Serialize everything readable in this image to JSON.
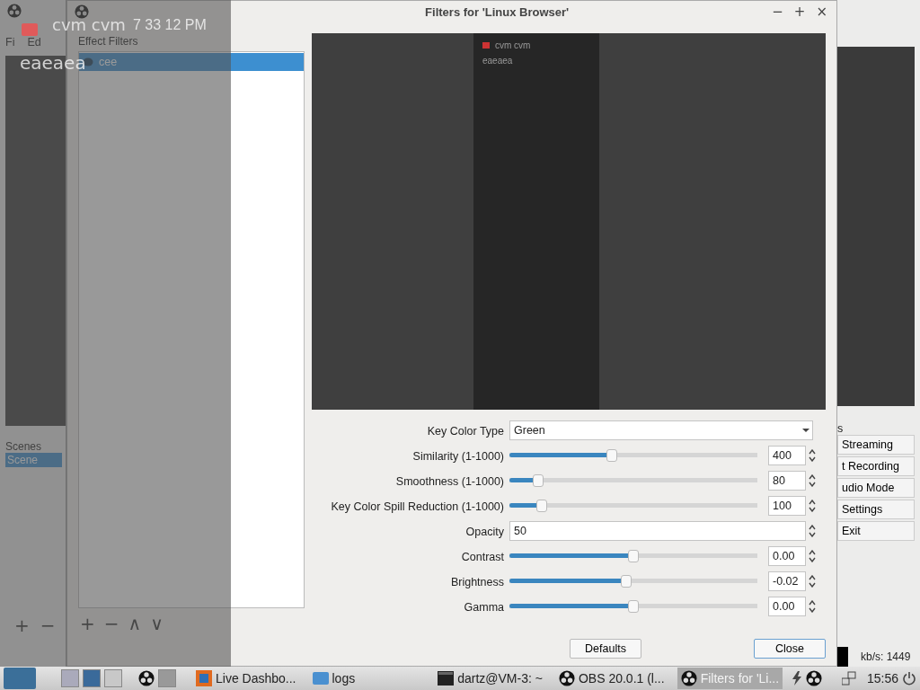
{
  "main_window": {
    "menu": [
      "Fi",
      "Ed"
    ],
    "scenes_label": "Scenes",
    "scenes": [
      {
        "label": "Scene",
        "selected": true
      }
    ],
    "scene_buttons": [
      "+",
      "−"
    ],
    "controls_label": "s",
    "controls": [
      "Streaming",
      "t Recording",
      "udio Mode",
      "Settings",
      "Exit"
    ],
    "bitrate": "kb/s: 1449"
  },
  "dialog": {
    "title": "Filters for 'Linux Browser'",
    "title_buttons": [
      "−",
      "+",
      "×"
    ],
    "effect_filters_label": "Effect Filters",
    "filters": [
      {
        "label": "cee",
        "selected": true
      }
    ],
    "filter_buttons": [
      "+",
      "−",
      "∧",
      "∨"
    ],
    "preview": {
      "source_lines": [
        "cvm cvm",
        "eaeaea"
      ]
    },
    "properties": [
      {
        "kind": "select",
        "label": "Key Color Type",
        "value": "Green"
      },
      {
        "kind": "slider",
        "label": "Similarity (1-1000)",
        "level": 0.41,
        "value": "400"
      },
      {
        "kind": "slider",
        "label": "Smoothness (1-1000)",
        "level": 0.1,
        "value": "80"
      },
      {
        "kind": "slider",
        "label": "Key Color Spill Reduction (1-1000)",
        "level": 0.115,
        "value": "100"
      },
      {
        "kind": "spin",
        "label": "Opacity",
        "value": "50"
      },
      {
        "kind": "slider",
        "label": "Contrast",
        "level": 0.5,
        "value": "0.00"
      },
      {
        "kind": "slider",
        "label": "Brightness",
        "level": 0.47,
        "value": "-0.02"
      },
      {
        "kind": "slider",
        "label": "Gamma",
        "level": 0.5,
        "value": "0.00"
      }
    ],
    "buttons": [
      {
        "label": "Defaults",
        "focused": false
      },
      {
        "label": "Close",
        "focused": true
      }
    ]
  },
  "overlay": {
    "title": "cvm cvm",
    "time": "7 33 12 PM",
    "text": "eaeaea"
  },
  "taskbar": {
    "tasks": [
      {
        "kind": "browser",
        "label": "Live Dashbo...",
        "selected": false
      },
      {
        "kind": "folder",
        "label": "logs",
        "selected": false
      },
      {
        "kind": "terminal",
        "label": "dartz@VM-3: ~",
        "selected": false
      },
      {
        "kind": "obs",
        "label": "OBS 20.0.1 (l...",
        "selected": false
      },
      {
        "kind": "obs",
        "label": "Filters for 'Li...",
        "selected": true
      }
    ],
    "clock": "15:56"
  }
}
